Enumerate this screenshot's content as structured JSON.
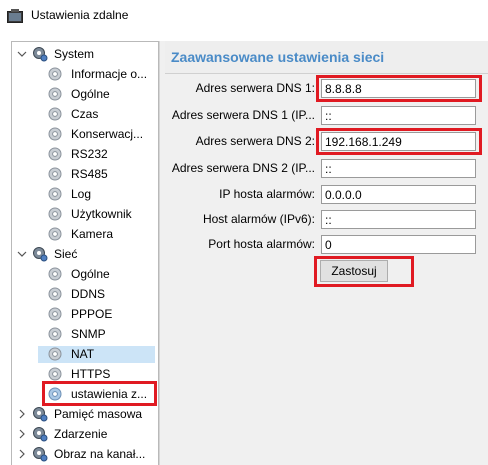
{
  "window": {
    "title": "Ustawienia zdalne"
  },
  "tree": {
    "items": [
      {
        "label": "System",
        "level": 0,
        "expanded": true
      },
      {
        "label": "Informacje o...",
        "level": 1
      },
      {
        "label": "Ogólne",
        "level": 1
      },
      {
        "label": "Czas",
        "level": 1
      },
      {
        "label": "Konserwacj...",
        "level": 1
      },
      {
        "label": "RS232",
        "level": 1
      },
      {
        "label": "RS485",
        "level": 1
      },
      {
        "label": "Log",
        "level": 1
      },
      {
        "label": "Użytkownik",
        "level": 1
      },
      {
        "label": "Kamera",
        "level": 1
      },
      {
        "label": "Sieć",
        "level": 0,
        "expanded": true
      },
      {
        "label": "Ogólne",
        "level": 1
      },
      {
        "label": "DDNS",
        "level": 1
      },
      {
        "label": "PPPOE",
        "level": 1
      },
      {
        "label": "SNMP",
        "level": 1
      },
      {
        "label": "NAT",
        "level": 1
      },
      {
        "label": "HTTPS",
        "level": 1
      },
      {
        "label": "ustawienia z...",
        "level": 1,
        "selected": true
      },
      {
        "label": "Pamięć masowa",
        "level": 0,
        "expanded": false
      },
      {
        "label": "Zdarzenie",
        "level": 0,
        "expanded": false
      },
      {
        "label": "Obraz na kanał...",
        "level": 0,
        "expanded": false
      }
    ]
  },
  "panel": {
    "title": "Zaawansowane ustawienia sieci",
    "fields": [
      {
        "label": "Adres serwera DNS 1:",
        "value": "8.8.8.8"
      },
      {
        "label": "Adres serwera DNS 1 (IP...",
        "value": "::"
      },
      {
        "label": "Adres serwera DNS 2:",
        "value": "192.168.1.249"
      },
      {
        "label": "Adres serwera DNS 2 (IP...",
        "value": "::"
      },
      {
        "label": "IP hosta alarmów:",
        "value": "0.0.0.0"
      },
      {
        "label": "Host alarmów (IPv6):",
        "value": "::"
      },
      {
        "label": "Port hosta alarmów:",
        "value": "0"
      }
    ],
    "apply_label": "Zastosuj"
  },
  "colors": {
    "highlight": "#e01a22",
    "title_blue": "#4a8bc7",
    "selection": "#cce4f7"
  }
}
